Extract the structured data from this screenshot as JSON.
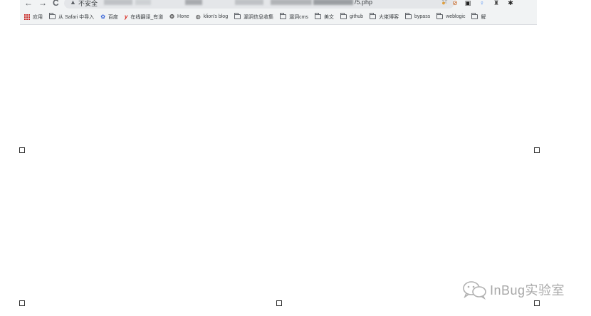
{
  "browser": {
    "nav": {
      "back": "←",
      "forward": "→",
      "reload": "C"
    },
    "address_bar": {
      "security_icon": "warning-triangle-icon",
      "security_label": "不安全",
      "url_visible_suffix": "/5.php"
    },
    "extensions": [
      "cookie-icon",
      "block-icon",
      "h-icon",
      "pin-icon",
      "figure-icon",
      "puzzle-icon"
    ]
  },
  "bookmarks": [
    {
      "label": "应用",
      "icon": "apps-grid-icon"
    },
    {
      "label": "从 Safari 中导入",
      "icon": "folder-icon"
    },
    {
      "label": "百度",
      "icon": "baidu-icon"
    },
    {
      "label": "在线翻译_有道",
      "icon": "youdao-icon"
    },
    {
      "label": "Hone",
      "icon": "hone-icon"
    },
    {
      "label": "klion's blog",
      "icon": "globe-icon"
    },
    {
      "label": "漏洞信息收集",
      "icon": "folder-icon"
    },
    {
      "label": "漏洞cms",
      "icon": "folder-icon"
    },
    {
      "label": "美文",
      "icon": "folder-icon"
    },
    {
      "label": "github",
      "icon": "folder-icon"
    },
    {
      "label": "大佬博客",
      "icon": "folder-icon"
    },
    {
      "label": "bypass",
      "icon": "folder-icon"
    },
    {
      "label": "weblogic",
      "icon": "folder-icon"
    },
    {
      "label": "解",
      "icon": "folder-icon"
    }
  ],
  "watermark": {
    "text": "InBug实验室"
  }
}
